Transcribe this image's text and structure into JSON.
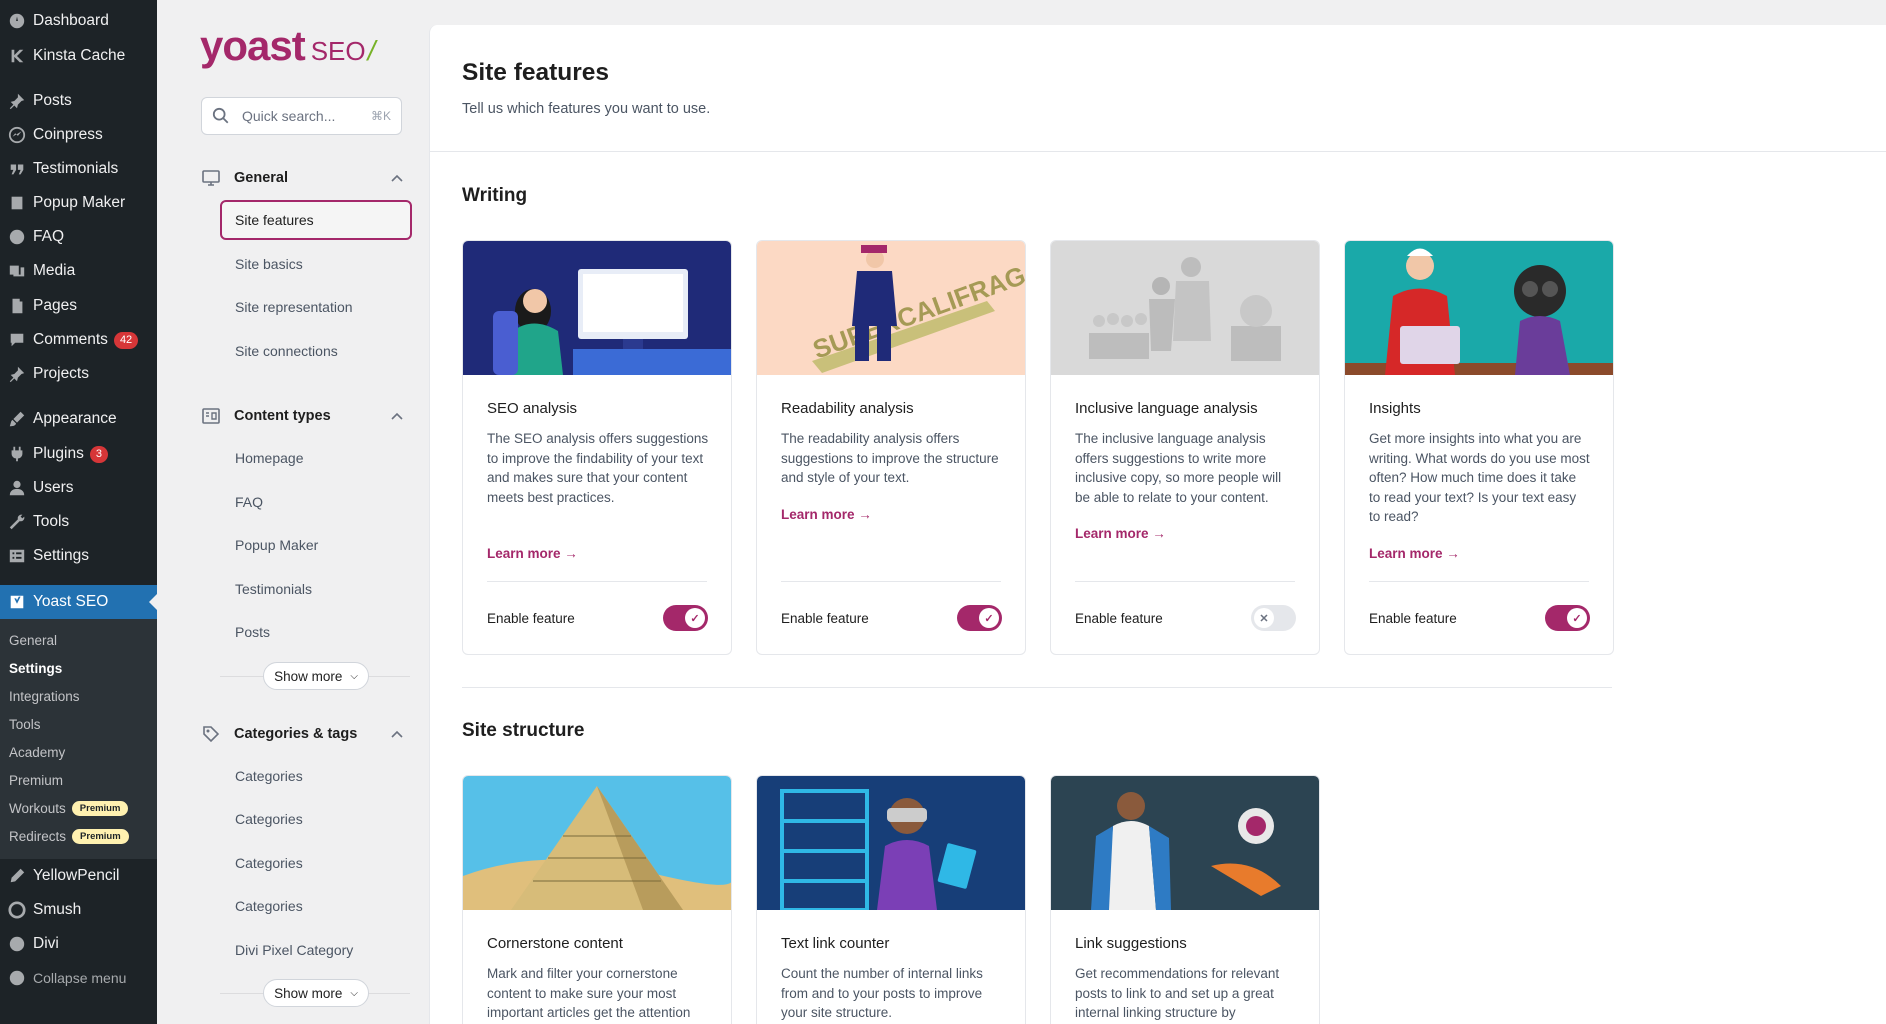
{
  "wp_menu": {
    "items": [
      {
        "label": "Dashboard",
        "icon": "dashboard-icon"
      },
      {
        "label": "Kinsta Cache",
        "icon": "kinsta-icon"
      },
      {
        "label": "Posts",
        "icon": "pin-icon"
      },
      {
        "label": "Coinpress",
        "icon": "coinpress-icon"
      },
      {
        "label": "Testimonials",
        "icon": "quote-icon"
      },
      {
        "label": "Popup Maker",
        "icon": "popup-icon"
      },
      {
        "label": "FAQ",
        "icon": "question-icon"
      },
      {
        "label": "Media",
        "icon": "media-icon"
      },
      {
        "label": "Pages",
        "icon": "page-icon"
      },
      {
        "label": "Comments",
        "icon": "comment-icon",
        "badge": "42"
      },
      {
        "label": "Projects",
        "icon": "pin-icon"
      },
      {
        "label": "Appearance",
        "icon": "brush-icon"
      },
      {
        "label": "Plugins",
        "icon": "plugin-icon",
        "badge": "3"
      },
      {
        "label": "Users",
        "icon": "user-icon"
      },
      {
        "label": "Tools",
        "icon": "wrench-icon"
      },
      {
        "label": "Settings",
        "icon": "settings-icon"
      },
      {
        "label": "Yoast SEO",
        "icon": "yoast-icon"
      },
      {
        "label": "YellowPencil",
        "icon": "pencil-icon"
      },
      {
        "label": "Smush",
        "icon": "smush-icon"
      },
      {
        "label": "Divi",
        "icon": "divi-icon"
      },
      {
        "label": "Collapse menu",
        "icon": "collapse-icon"
      }
    ],
    "submenu": [
      {
        "label": "General"
      },
      {
        "label": "Settings"
      },
      {
        "label": "Integrations"
      },
      {
        "label": "Tools"
      },
      {
        "label": "Academy"
      },
      {
        "label": "Premium"
      },
      {
        "label": "Workouts",
        "badge": "Premium"
      },
      {
        "label": "Redirects",
        "badge": "Premium"
      }
    ]
  },
  "yoast_nav": {
    "logo_text": "yoast",
    "logo_seo": "SEO",
    "logo_slash": "/",
    "search_placeholder": "Quick search...",
    "search_shortcut": "⌘K",
    "general": {
      "title": "General",
      "items": [
        "Site features",
        "Site basics",
        "Site representation",
        "Site connections"
      ]
    },
    "content_types": {
      "title": "Content types",
      "items": [
        "Homepage",
        "FAQ",
        "Popup Maker",
        "Testimonials",
        "Posts"
      ],
      "show_more": "Show more"
    },
    "categories_tags": {
      "title": "Categories & tags",
      "items": [
        "Categories",
        "Categories",
        "Categories",
        "Categories",
        "Divi Pixel Category"
      ],
      "show_more": "Show more"
    }
  },
  "page": {
    "title": "Site features",
    "subtitle": "Tell us which features you want to use.",
    "writing_title": "Writing",
    "structure_title": "Site structure",
    "learn_more": "Learn more →",
    "enable_feature": "Enable feature",
    "writing_cards": [
      {
        "title": "SEO analysis",
        "desc": "The SEO analysis offers suggestions to improve the findability of your text and makes sure that your content meets best practices.",
        "enabled": true,
        "colors": {
          "bg": "#1f2a78"
        }
      },
      {
        "title": "Readability analysis",
        "desc": "The readability analysis offers suggestions to improve the structure and style of your text.",
        "enabled": true,
        "colors": {
          "bg": "#fcd9c4"
        }
      },
      {
        "title": "Inclusive language analysis",
        "desc": "The inclusive language analysis offers suggestions to write more inclusive copy, so more people will be able to relate to your content.",
        "enabled": false,
        "colors": {
          "bg": "#d9d9d9"
        }
      },
      {
        "title": "Insights",
        "desc": "Get more insights into what you are writing. What words do you use most often? How much time does it take to read your text? Is your text easy to read?",
        "enabled": true,
        "colors": {
          "bg": "#1aa9a9"
        }
      }
    ],
    "structure_cards": [
      {
        "title": "Cornerstone content",
        "desc": "Mark and filter your cornerstone content to make sure your most important articles get the attention"
      },
      {
        "title": "Text link counter",
        "desc": "Count the number of internal links from and to your posts to improve your site structure."
      },
      {
        "title": "Link suggestions",
        "desc": "Get recommendations for relevant posts to link to and set up a great internal linking structure by"
      }
    ]
  },
  "colors": {
    "brand": "#a4286a",
    "wp_menu_bg": "#1d2327",
    "wp_active": "#2271b1"
  }
}
